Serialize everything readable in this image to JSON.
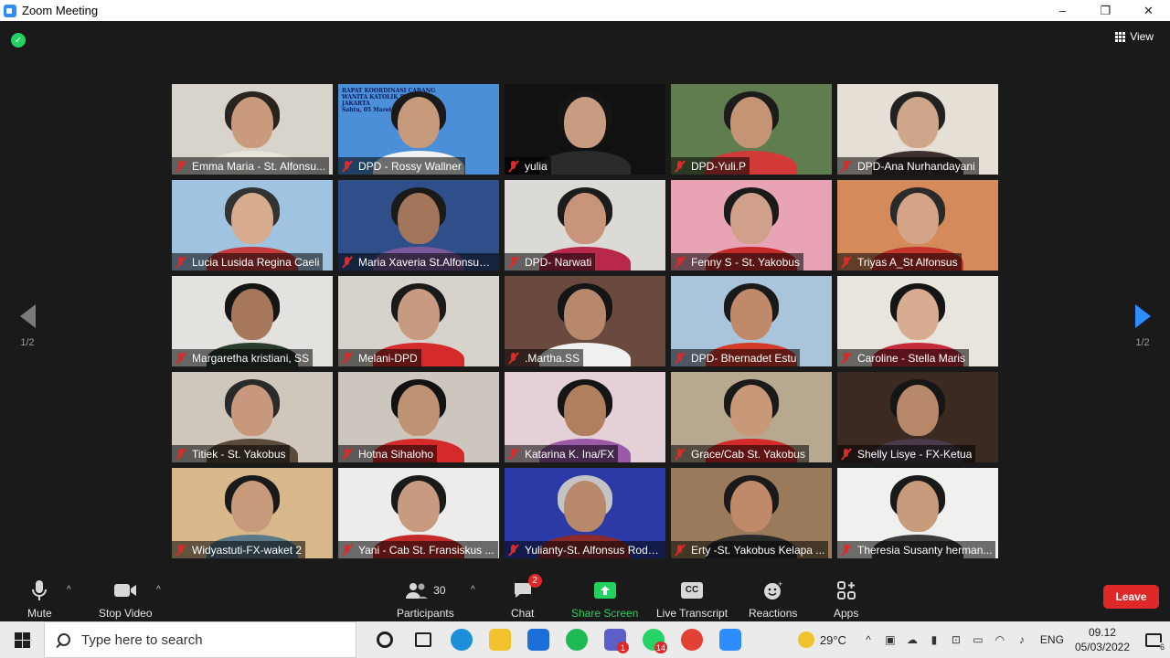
{
  "window": {
    "title": "Zoom Meeting",
    "controls": [
      "–",
      "❐",
      "✕"
    ]
  },
  "header": {
    "view_label": "View"
  },
  "pager": {
    "left_label": "1/2",
    "right_label": "1/2"
  },
  "participants_grid": [
    {
      "name": "Emma Maria - St. Alfonsu...",
      "bg": "#d8d4cc",
      "hair": "#2a2420",
      "skin": "#c99a7c",
      "shirt": "#e8e4dc"
    },
    {
      "name": "DPD - Rossy Wallner",
      "bg": "#4a8fd8",
      "hair": "#1a1a1a",
      "skin": "#c69a7a",
      "shirt": "#f2f2f2",
      "banner": "RAPAT KOORDINASI CABANG\nWANITA KATOLIK RI - DPD JAKARTA\nSabtu, 05 Maret 2022"
    },
    {
      "name": "yulia",
      "bg": "#111111",
      "hair": "#151515",
      "skin": "#c79c80",
      "shirt": "#2a2a2a"
    },
    {
      "name": "DPD-Yuli.P",
      "bg": "#5f7d4e",
      "hair": "#1c1c1c",
      "skin": "#c49474",
      "shirt": "#d23a3a"
    },
    {
      "name": "DPD-Ana Nurhandayani",
      "bg": "#e6dfd6",
      "hair": "#222",
      "skin": "#d0a68a",
      "shirt": "#3c3030"
    },
    {
      "name": "Lucia Lusida Regina Caeli",
      "bg": "#9fc3e0",
      "hair": "#333",
      "skin": "#d6ab8e",
      "shirt": "#c43a3a"
    },
    {
      "name": "Maria Xaveria St.Alfonsus Ro...",
      "bg": "#2f4f8a",
      "hair": "#1a1a1a",
      "skin": "#a3755a",
      "shirt": "#7a5a9a",
      "active": true
    },
    {
      "name": "DPD- Narwati",
      "bg": "#dcdad6",
      "hair": "#1c1c1c",
      "skin": "#c8957a",
      "shirt": "#b8284a"
    },
    {
      "name": "Fenny S - St. Yakobus",
      "bg": "#e8a4b4",
      "hair": "#1a1a1a",
      "skin": "#d0a08a",
      "shirt": "#c42a2a"
    },
    {
      "name": "Triyas A_St Alfonsus",
      "bg": "#d48a5a",
      "hair": "#2a2a2a",
      "skin": "#d4a488",
      "shirt": "#c4342a"
    },
    {
      "name": "Margaretha kristiani, SS",
      "bg": "#e4e2de",
      "hair": "#151515",
      "skin": "#a8785c",
      "shirt": "#2a3a2a"
    },
    {
      "name": "Melani-DPD",
      "bg": "#d8d2cc",
      "hair": "#1a1a1a",
      "skin": "#c89a80",
      "shirt": "#d42a2a"
    },
    {
      "name": ".Martha.SS",
      "bg": "#6a4a3e",
      "hair": "#151515",
      "skin": "#b8886c",
      "shirt": "#f0f0f0"
    },
    {
      "name": "DPD- Bhernadet Estu",
      "bg": "#aac4dc",
      "hair": "#1a1a1a",
      "skin": "#c08a6a",
      "shirt": "#d43a2a"
    },
    {
      "name": "Caroline - Stella Maris",
      "bg": "#e8e4de",
      "hair": "#151515",
      "skin": "#d8ac90",
      "shirt": "#c42a3a"
    },
    {
      "name": "Titiek - St. Yakobus",
      "bg": "#cfc6bc",
      "hair": "#2a2a2a",
      "skin": "#c8987c",
      "shirt": "#5a4a3a"
    },
    {
      "name": "Hotna Sihaloho",
      "bg": "#cdc6be",
      "hair": "#121212",
      "skin": "#c09274",
      "shirt": "#d42a2a"
    },
    {
      "name": "Katarina K. Ina/FX",
      "bg": "#e6d0d8",
      "hair": "#151515",
      "skin": "#b0805e",
      "shirt": "#9a5aa8"
    },
    {
      "name": "Grace/Cab St. Yakobus",
      "bg": "#b8a890",
      "hair": "#1a1a1a",
      "skin": "#c89878",
      "shirt": "#d42a2a"
    },
    {
      "name": "Shelly Lisye - FX-Ketua",
      "bg": "#3a2a22",
      "hair": "#151515",
      "skin": "#b8886a",
      "shirt": "#4a3a4a"
    },
    {
      "name": "Widyastuti-FX-waket 2",
      "bg": "#d8b88a",
      "hair": "#1a1a1a",
      "skin": "#c89a7c",
      "shirt": "#5a7a8a"
    },
    {
      "name": "Yani - Cab St. Fransiskus ...",
      "bg": "#ececec",
      "hair": "#1a1a1a",
      "skin": "#c89a80",
      "shirt": "#c42a2a"
    },
    {
      "name": "Yulianty-St. Alfonsus Rodrig...",
      "bg": "#2c3aa8",
      "hair": "#c4c4c4",
      "skin": "#b8886a",
      "shirt": "#8a2a2a"
    },
    {
      "name": "Erty -St. Yakobus Kelapa ...",
      "bg": "#9a7a5a",
      "hair": "#1a1a1a",
      "skin": "#c08a6a",
      "shirt": "#2a2a2a"
    },
    {
      "name": "Theresia Susanty herman...",
      "bg": "#f0f0ee",
      "hair": "#1a1a1a",
      "skin": "#c89a7c",
      "shirt": "#3a3a3a"
    }
  ],
  "toolbar": {
    "mute_label": "Mute",
    "stop_video_label": "Stop Video",
    "participants_label": "Participants",
    "participants_count": "30",
    "chat_label": "Chat",
    "chat_badge": "2",
    "share_screen_label": "Share Screen",
    "live_transcript_label": "Live Transcript",
    "live_transcript_icon_text": "CC",
    "reactions_label": "Reactions",
    "apps_label": "Apps",
    "leave_label": "Leave"
  },
  "taskbar": {
    "search_placeholder": "Type here to search",
    "apps": [
      {
        "name": "cortana",
        "color": "#1f1f1f"
      },
      {
        "name": "task-view",
        "color": "#1f1f1f"
      },
      {
        "name": "edge",
        "color": "#1c8fd8"
      },
      {
        "name": "file-explorer",
        "color": "#f2c12e"
      },
      {
        "name": "mail",
        "color": "#1c6fd8"
      },
      {
        "name": "spotify",
        "color": "#1db954"
      },
      {
        "name": "teams",
        "color": "#5b5fc7",
        "badge": "1"
      },
      {
        "name": "whatsapp",
        "color": "#25d366",
        "badge": "14"
      },
      {
        "name": "chrome",
        "color": "#e34133"
      },
      {
        "name": "zoom",
        "color": "#2d8cff"
      }
    ],
    "weather_temp": "29°C",
    "language": "ENG",
    "time": "09.12",
    "date": "05/03/2022",
    "notification_count": "6"
  },
  "colors": {
    "accent_blue": "#2d8cff",
    "leave_red": "#e02828",
    "share_green": "#23d160",
    "active_speaker": "#e3e35a"
  }
}
